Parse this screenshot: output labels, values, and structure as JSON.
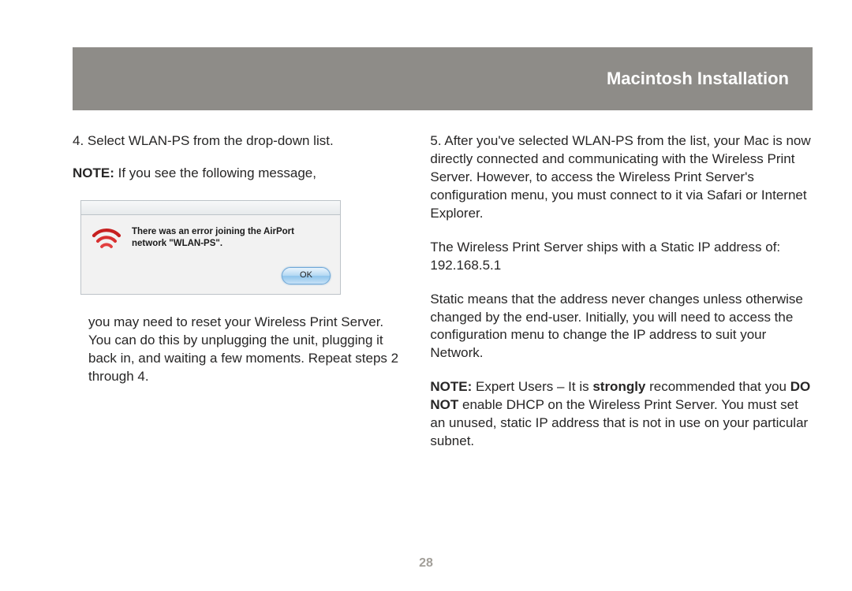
{
  "header": {
    "title": "Macintosh Installation"
  },
  "left": {
    "step4": "4. Select WLAN-PS from the drop-down list.",
    "note_label": "NOTE:",
    "note_intro_rest": " If you see the following message,",
    "dialog": {
      "message_line1": "There was an error joining the AirPort",
      "message_line2": "network \"WLAN-PS\".",
      "ok": "OK"
    },
    "after_dialog": "you may need to reset your Wireless Print Server. You can do this by unplugging the unit, plugging it back in, and waiting a few moments. Repeat steps 2 through 4."
  },
  "right": {
    "step5": "5. After you've selected WLAN-PS from the list, your Mac is now directly connected and communicating with the Wireless Print Server. However, to access the Wireless Print Server's configuration menu, you must connect to it via Safari or Internet Explorer.",
    "static_ip": "The Wireless Print Server ships with a Static IP address of: 192.168.5.1",
    "static_explain": "Static means that the address never changes unless otherwise changed by the end-user. Initially, you will need to access the configuration menu to change the IP address to suit your Network.",
    "note2_label": "NOTE:",
    "note2_part1": " Expert Users – It is ",
    "note2_strongly": "strongly",
    "note2_part2": " recommended that you ",
    "note2_donot": "DO NOT",
    "note2_part3": " enable DHCP on the Wireless Print Server. You must set an unused, static IP address that is not in use on your particular subnet."
  },
  "page_number": "28"
}
